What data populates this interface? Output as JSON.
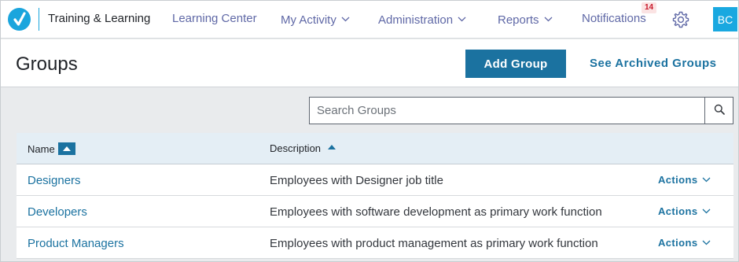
{
  "nav": {
    "app_title": "Training & Learning",
    "links": [
      {
        "label": "Learning Center",
        "has_dropdown": false
      },
      {
        "label": "My Activity",
        "has_dropdown": true
      },
      {
        "label": "Administration",
        "has_dropdown": true
      },
      {
        "label": "Reports",
        "has_dropdown": true
      },
      {
        "label": "Notifications",
        "has_dropdown": false
      }
    ],
    "notification_count": "14",
    "avatar_initials": "BC"
  },
  "header": {
    "title": "Groups",
    "add_button": "Add Group",
    "archived_link": "See Archived Groups"
  },
  "search": {
    "placeholder": "Search Groups",
    "value": ""
  },
  "table": {
    "columns": [
      "Name",
      "Description"
    ],
    "sort": {
      "column": "Name",
      "direction": "ascending"
    },
    "rows": [
      {
        "name": "Designers",
        "description": "Employees with Designer job title",
        "actions": "Actions"
      },
      {
        "name": "Developers",
        "description": "Employees with software development as primary work function",
        "actions": "Actions"
      },
      {
        "name": "Product Managers",
        "description": "Employees with product management as primary work function",
        "actions": "Actions"
      }
    ]
  },
  "colors": {
    "brand": "#1aa5dd",
    "primary": "#1b72a0",
    "nav_link": "#5f68a6",
    "badge_text": "#c8182a",
    "badge_bg": "#fbe3e3",
    "table_header_bg": "#e4eef5",
    "page_bg": "#e9ebed"
  },
  "icons": {
    "logo": "checkmark-logo-icon",
    "dropdown": "chevron-down-icon",
    "settings": "gear-icon",
    "search": "search-icon",
    "sort": "sort-ascending-icon"
  }
}
